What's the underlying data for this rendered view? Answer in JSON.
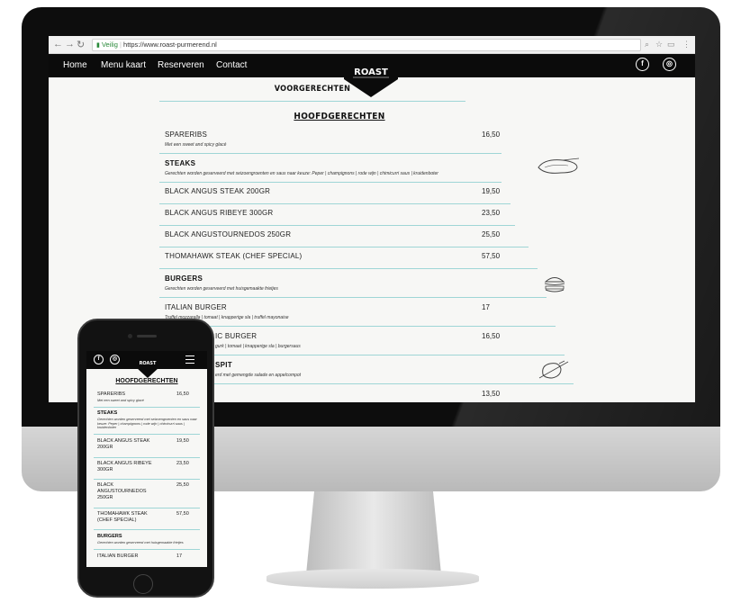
{
  "browser": {
    "secure_label": "Veilig",
    "url": "https://www.roast-purmerend.nl"
  },
  "nav": {
    "links": [
      "Home",
      "Menu kaart",
      "Reserveren",
      "Contact"
    ],
    "logo_text": "ROAST",
    "social": [
      "facebook-icon",
      "instagram-icon"
    ]
  },
  "menu": {
    "partial_heading": "VOORGERECHTEN",
    "section_title": "HOOFDGERECHTEN",
    "spareribs": {
      "name": "SPARERIBS",
      "desc": "Met een sweet and spicy glacé",
      "price": "16,50"
    },
    "steaks": {
      "category": "STEAKS",
      "desc": "Gerechten worden geserveerd met seizoengroenten en saus naar keuze: Peper | champignons | rode wijn | chimicurri saus | kruidenboter",
      "items": [
        {
          "name": "BLACK ANGUS STEAK 200GR",
          "price": "19,50"
        },
        {
          "name": "BLACK ANGUS RIBEYE 300GR",
          "price": "23,50"
        },
        {
          "name": "BLACK ANGUSTOURNEDOS 250GR",
          "price": "25,50"
        },
        {
          "name": "THOMAHAWK STEAK (CHEF SPECIAL)",
          "price": "57,50"
        }
      ]
    },
    "burgers": {
      "category": "BURGERS",
      "desc": "Gerechten worden geserveerd met huisgemaakte frietjes",
      "italian": {
        "name": "ITALIAN BURGER",
        "desc": "Truffel mozzarella | tomaat | knapperige sla | truffel mayonaise",
        "price": "17"
      },
      "classic": {
        "name": "IC BURGER",
        "desc": "gurk | tomaat | knapperige sla | burgersaus",
        "price": "16,50"
      }
    },
    "spit": {
      "name": "SPIT",
      "desc": "erd met gemengde salade en appelcompot",
      "price": "13,50"
    }
  },
  "phone": {
    "title": "HOOFDGERECHTEN",
    "spareribs": {
      "name": "SPARERIBS",
      "desc": "Met een sweet and spicy glacé",
      "price": "16,50"
    },
    "steaks_cat": "STEAKS",
    "steaks_desc": "Gerechten worden geserveerd met seizoengroenten en saus naar keuze: Peper | champignons | rode wijn | chimicurri saus | kruidenboter",
    "items": [
      {
        "name": "BLACK ANGUS STEAK 200GR",
        "price": "19,50"
      },
      {
        "name": "BLACK ANGUS RIBEYE 300GR",
        "price": "23,50"
      },
      {
        "name": "BLACK ANGUSTOURNEDOS 250GR",
        "price": "25,50"
      },
      {
        "name": "THOMAHAWK STEAK (CHEF SPECIAL)",
        "price": "57,50"
      }
    ],
    "burgers_cat": "BURGERS",
    "burgers_desc": "Gerechten worden geserveerd met huisgemaakte frietjes",
    "italian": {
      "name": "ITALIAN BURGER",
      "price": "17"
    }
  }
}
